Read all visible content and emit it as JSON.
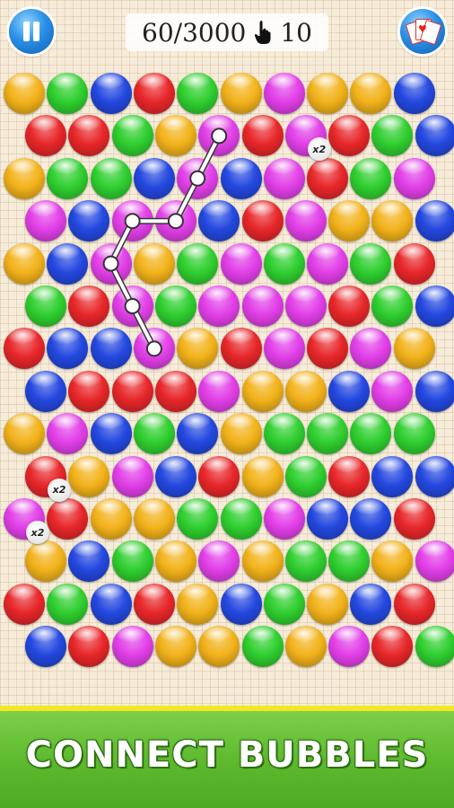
{
  "hud": {
    "score": "60/3000",
    "moves": "10",
    "pause_icon": "pause-icon",
    "cards_icon": "playing-cards-icon",
    "hand_icon": "pointing-hand-icon"
  },
  "banner": {
    "text": "CONNECT BUBBLES"
  },
  "colors": {
    "Y": "#f2b21a",
    "G": "#2fcf2f",
    "B": "#2448e0",
    "R": "#e8272a",
    "P": "#e23fe8"
  },
  "grid": [
    [
      "Y",
      "G",
      "B",
      "R",
      "G",
      "Y",
      "P",
      "Y",
      "Y",
      "B"
    ],
    [
      "R",
      "R",
      "G",
      "Y",
      "P",
      "R",
      "P",
      "R",
      "G",
      "B"
    ],
    [
      "Y",
      "G",
      "G",
      "B",
      "P",
      "B",
      "P",
      "R",
      "G",
      "P"
    ],
    [
      "P",
      "B",
      "P",
      "P",
      "B",
      "R",
      "P",
      "Y",
      "Y",
      "B"
    ],
    [
      "Y",
      "B",
      "P",
      "Y",
      "G",
      "P",
      "G",
      "P",
      "G",
      "R"
    ],
    [
      "G",
      "R",
      "P",
      "G",
      "P",
      "P",
      "P",
      "R",
      "G",
      "B"
    ],
    [
      "R",
      "B",
      "B",
      "P",
      "Y",
      "R",
      "P",
      "R",
      "P",
      "Y"
    ],
    [
      "B",
      "R",
      "R",
      "R",
      "P",
      "Y",
      "Y",
      "B",
      "P",
      "B"
    ],
    [
      "Y",
      "P",
      "B",
      "G",
      "B",
      "Y",
      "G",
      "G",
      "G",
      "G"
    ],
    [
      "R",
      "Y",
      "P",
      "B",
      "R",
      "Y",
      "G",
      "R",
      "B",
      "B"
    ],
    [
      "P",
      "R",
      "Y",
      "Y",
      "G",
      "G",
      "P",
      "B",
      "B",
      "R"
    ],
    [
      "Y",
      "B",
      "G",
      "Y",
      "P",
      "Y",
      "G",
      "G",
      "Y",
      "P"
    ],
    [
      "R",
      "G",
      "B",
      "R",
      "Y",
      "B",
      "G",
      "Y",
      "B",
      "R"
    ],
    [
      "B",
      "R",
      "P",
      "Y",
      "Y",
      "G",
      "Y",
      "P",
      "R",
      "G"
    ]
  ],
  "multipliers": [
    {
      "row": 1,
      "col": 6,
      "label": "x2"
    },
    {
      "row": 9,
      "col": 0,
      "label": "x2"
    },
    {
      "row": 10,
      "col": 0,
      "label": "x2"
    }
  ],
  "selected_path": [
    {
      "row": 1,
      "col": 4
    },
    {
      "row": 2,
      "col": 4
    },
    {
      "row": 3,
      "col": 3
    },
    {
      "row": 3,
      "col": 2
    },
    {
      "row": 4,
      "col": 2
    },
    {
      "row": 5,
      "col": 2
    },
    {
      "row": 6,
      "col": 3
    }
  ]
}
